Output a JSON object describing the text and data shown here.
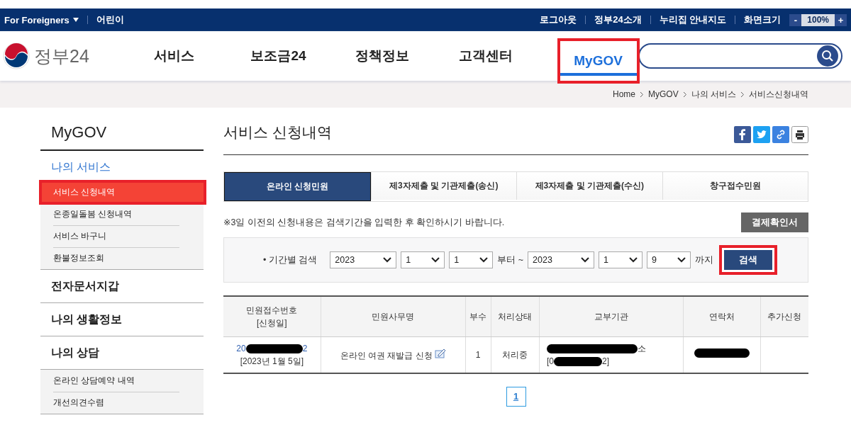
{
  "top_bar": {
    "language": "For Foreigners",
    "kids": "어린이",
    "links": [
      "로그아웃",
      "정부24소개",
      "누리집 안내지도"
    ],
    "zoom_label": "화면크기",
    "zoom_minus": "-",
    "zoom_value": "100%",
    "zoom_plus": "+"
  },
  "header": {
    "logo": "정부24",
    "nav": [
      {
        "label": "서비스",
        "selected": false,
        "highlighted": false
      },
      {
        "label": "보조금24",
        "selected": false,
        "highlighted": false
      },
      {
        "label": "정책정보",
        "selected": false,
        "highlighted": false
      },
      {
        "label": "고객센터",
        "selected": false,
        "highlighted": false
      },
      {
        "label": "MyGOV",
        "selected": true,
        "highlighted": true
      }
    ]
  },
  "breadcrumb": [
    "Home",
    "MyGOV",
    "나의 서비스",
    "서비스신청내역"
  ],
  "sidebar": {
    "title": "MyGOV",
    "sections": [
      {
        "label": "나의 서비스",
        "selected": true,
        "items": [
          {
            "label": "서비스 신청내역",
            "selected": true,
            "highlighted": true
          },
          {
            "label": "온종일돌봄 신청내역",
            "selected": false,
            "highlighted": false
          },
          {
            "label": "서비스 바구니",
            "selected": false,
            "highlighted": false
          },
          {
            "label": "환불정보조회",
            "selected": false,
            "highlighted": false
          }
        ]
      },
      {
        "label": "전자문서지갑",
        "selected": false
      },
      {
        "label": "나의 생활정보",
        "selected": false
      },
      {
        "label": "나의 상담",
        "selected": false,
        "items": [
          {
            "label": "온라인 상담예약 내역",
            "selected": false,
            "highlighted": false
          },
          {
            "label": "개선의견수렴",
            "selected": false,
            "highlighted": false
          }
        ]
      }
    ]
  },
  "page": {
    "title": "서비스 신청내역",
    "tabs": [
      {
        "label": "온라인 신청민원",
        "selected": true
      },
      {
        "label": "제3자제출 및 기관제출(송신)",
        "selected": false
      },
      {
        "label": "제3자제출 및 기관제출(수신)",
        "selected": false
      },
      {
        "label": "창구접수민원",
        "selected": false
      }
    ],
    "notice": "※3일 이전의 신청내용은 검색기간을 입력한 후 확인하시기 바랍니다.",
    "receipt_button": "결제확인서",
    "search": {
      "label": "• 기간별 검색",
      "from": [
        "2023",
        "1",
        "1"
      ],
      "from_suffix": "부터 ~",
      "to": [
        "2023",
        "1",
        "9"
      ],
      "to_suffix": "까지",
      "button": "검색",
      "button_highlighted": true
    },
    "table": {
      "columns": [
        "민원접수번호\n[신청일]",
        "민원사무명",
        "부수",
        "처리상태",
        "교부기관",
        "연락처",
        "추가신청"
      ],
      "rows": [
        {
          "receipt_prefix": "20",
          "receipt_suffix": "2",
          "date": "[2023년 1월 5일]",
          "service": "온라인 여권 재발급 신청",
          "copies": "1",
          "status": "처리중",
          "agency_suffix": "소",
          "agency_code_prefix": "[0",
          "agency_code_suffix": "2]"
        }
      ]
    },
    "pagination": [
      {
        "label": "1",
        "selected": true
      }
    ]
  }
}
